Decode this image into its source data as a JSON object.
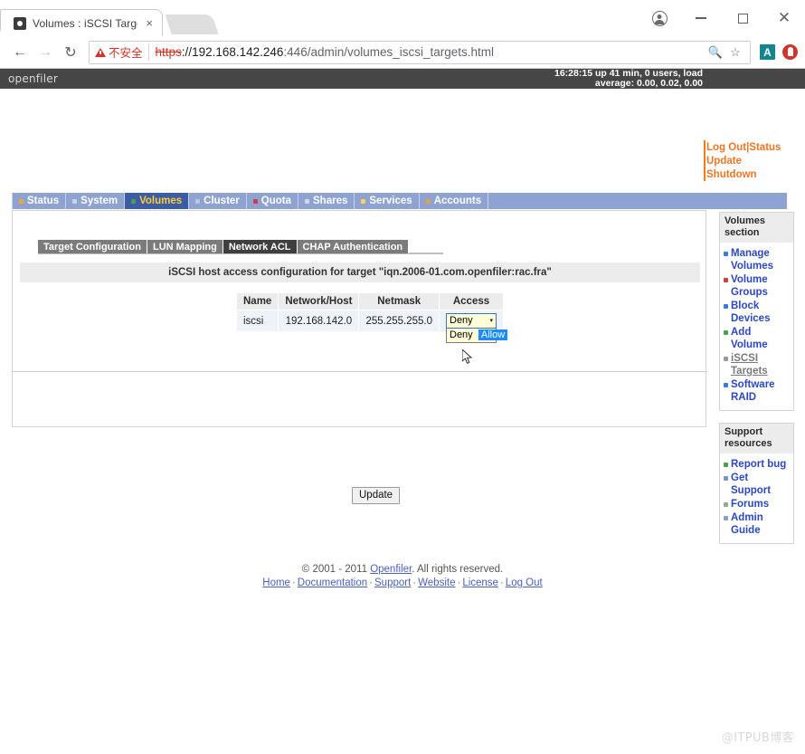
{
  "browser": {
    "tab": {
      "title": "Volumes : iSCSI Target",
      "close_label": "×",
      "favicon": "openfiler-favicon-icon"
    },
    "new_tab_label": "",
    "window_controls": {
      "profile": "profile-avatar-icon",
      "minimize": "minimize-icon",
      "maximize": "maximize-icon",
      "close": "close-icon"
    },
    "nav": {
      "back": "←",
      "forward": "→",
      "reload": "C"
    },
    "omnibox": {
      "security_label": "不安全",
      "url_scheme": "https",
      "url_separator": "://",
      "url_host": "192.168.142.246",
      "url_port": ":446",
      "url_path": "/admin/volumes_iscsi_targets.html",
      "zoom_icon": "zoom-out-icon",
      "bookmark_icon": "star-icon"
    },
    "extensions": [
      {
        "name": "adblock-extension-icon",
        "label": "A"
      },
      {
        "name": "red-shield-extension-icon",
        "label": ""
      }
    ]
  },
  "openfiler": {
    "logo": "openfiler",
    "status_line": "16:28:15 up 41 min, 0 users, load average: 0.00, 0.02, 0.00",
    "top_links": [
      {
        "label": "Log Out",
        "name": "log-out-link"
      },
      {
        "label": "Status",
        "name": "status-link"
      },
      {
        "label": "Update",
        "name": "update-link"
      },
      {
        "label": "Shutdown",
        "name": "shutdown-link"
      }
    ],
    "top_links_separator": "|",
    "nav_tabs": [
      {
        "label": "Status",
        "active": false,
        "dot": "#f0a830"
      },
      {
        "label": "System",
        "active": false,
        "dot": "#c9d2e8"
      },
      {
        "label": "Volumes",
        "active": true,
        "dot": "#4aa04a"
      },
      {
        "label": "Cluster",
        "active": false,
        "dot": "#b9c4dd"
      },
      {
        "label": "Quota",
        "active": false,
        "dot": "#cf3f3f"
      },
      {
        "label": "Shares",
        "active": false,
        "dot": "#d0d7e8"
      },
      {
        "label": "Services",
        "active": false,
        "dot": "#ffd34d"
      },
      {
        "label": "Accounts",
        "active": false,
        "dot": "#e0a34a"
      }
    ],
    "sub_tabs": [
      {
        "label": "Target Configuration",
        "active": false
      },
      {
        "label": "LUN Mapping",
        "active": false
      },
      {
        "label": "Network ACL",
        "active": true
      },
      {
        "label": "CHAP Authentication",
        "active": false
      }
    ],
    "banner": "iSCSI host access configuration for target \"iqn.2006-01.com.openfiler:rac.fra\"",
    "table": {
      "headers": [
        "Name",
        "Network/Host",
        "Netmask",
        "Access"
      ],
      "rows": [
        {
          "name": "iscsi",
          "network": "192.168.142.0",
          "netmask": "255.255.255.0",
          "access_selected": "Deny"
        }
      ],
      "access_options": [
        {
          "label": "Deny",
          "highlighted": false
        },
        {
          "label": "Allow",
          "highlighted": true
        }
      ],
      "select_arrow": "▾"
    },
    "update_button": "Update",
    "sidebar": [
      {
        "title": "Volumes section",
        "name": "volumes-section",
        "items": [
          {
            "label": "Manage Volumes",
            "bullet": "#3a7bd5",
            "current": false
          },
          {
            "label": "Volume Groups",
            "bullet": "#cf3f3f",
            "current": false
          },
          {
            "label": "Block Devices",
            "bullet": "#3a7bd5",
            "current": false
          },
          {
            "label": "Add Volume",
            "bullet": "#4aa04a",
            "current": false
          },
          {
            "label": "iSCSI Targets",
            "bullet": "#9a9a9a",
            "current": true
          },
          {
            "label": "Software RAID",
            "bullet": "#3a7bd5",
            "current": false
          }
        ]
      },
      {
        "title": "Support resources",
        "name": "support-resources-section",
        "items": [
          {
            "label": "Report bug",
            "bullet": "#4aa04a",
            "current": false
          },
          {
            "label": "Get Support",
            "bullet": "#7f93c0",
            "current": false
          },
          {
            "label": "Forums",
            "bullet": "#8fae8f",
            "current": false
          },
          {
            "label": "Admin Guide",
            "bullet": "#8aa0cc",
            "current": false
          }
        ]
      }
    ],
    "footer": {
      "copyright_prefix": "© 2001 - 2011 ",
      "copyright_link": "Openfiler",
      "copyright_suffix": ". All rights reserved.",
      "links": [
        "Home",
        "Documentation",
        "Support",
        "Website",
        "License",
        "Log Out"
      ],
      "separator": "·"
    }
  },
  "watermark": "@ITPUB博客"
}
